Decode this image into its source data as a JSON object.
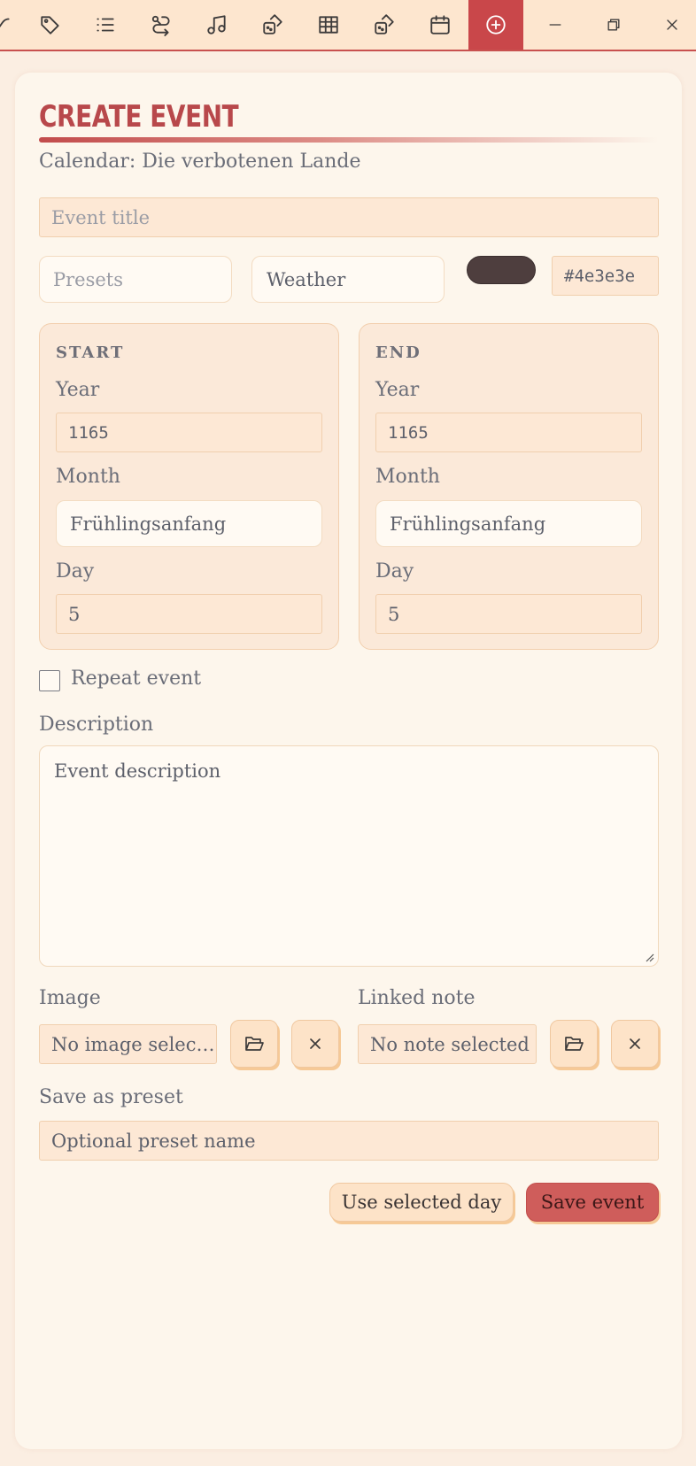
{
  "toolbar": {
    "items": [
      {
        "icon": "tag-icon"
      },
      {
        "icon": "list-icon"
      },
      {
        "icon": "route-icon"
      },
      {
        "icon": "music-icon"
      },
      {
        "icon": "dice-icon"
      },
      {
        "icon": "table-icon"
      },
      {
        "icon": "dice-icon"
      },
      {
        "icon": "calendar-icon"
      },
      {
        "icon": "plus-circle-icon",
        "active": true
      }
    ],
    "window": [
      "minimize-icon",
      "restore-icon",
      "close-icon"
    ],
    "active_color": "#c9474a",
    "background": "#fde6cf"
  },
  "form": {
    "title": "CREATE EVENT",
    "calendar_label": "Calendar: Die verbotenen Lande",
    "event_title_placeholder": "Event title",
    "presets_placeholder": "Presets",
    "category_value": "Weather",
    "color_hex": "#4e3e3e",
    "start": {
      "heading": "START",
      "year_label": "Year",
      "year": "1165",
      "month_label": "Month",
      "month": "Frühlingsanfang",
      "day_label": "Day",
      "day": "5"
    },
    "end": {
      "heading": "END",
      "year_label": "Year",
      "year": "1165",
      "month_label": "Month",
      "month": "Frühlingsanfang",
      "day_label": "Day",
      "day": "5"
    },
    "repeat_label": "Repeat event",
    "repeat_checked": false,
    "description_label": "Description",
    "description_placeholder": "Event description",
    "image_label": "Image",
    "image_value": "No image selec…",
    "linked_note_label": "Linked note",
    "linked_note_value": "No note selected",
    "preset_label": "Save as preset",
    "preset_placeholder": "Optional preset name",
    "use_selected_day": "Use selected day",
    "save_event": "Save event"
  }
}
